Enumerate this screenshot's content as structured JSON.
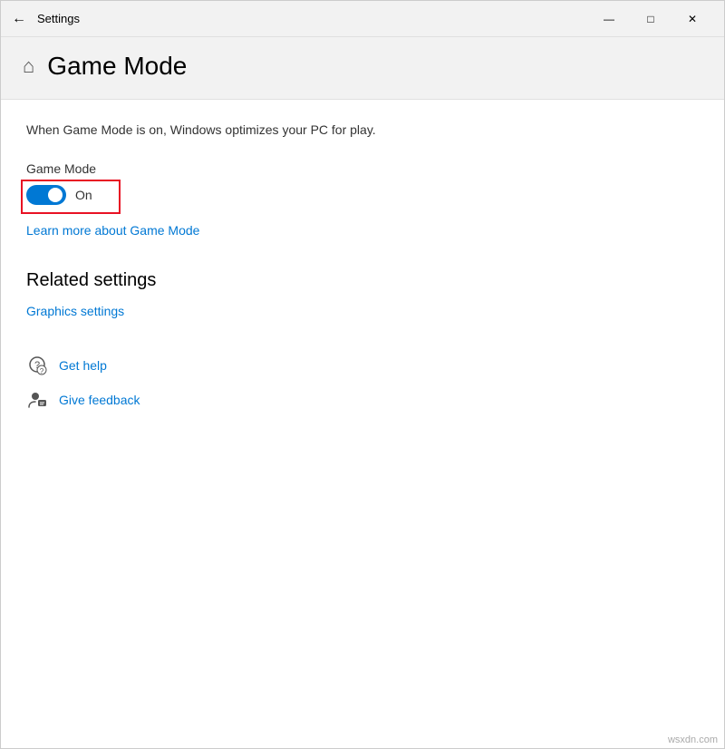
{
  "titleBar": {
    "title": "Settings",
    "backLabel": "←",
    "minimizeLabel": "—",
    "maximizeLabel": "□",
    "closeLabel": "✕"
  },
  "pageHeader": {
    "icon": "⌂",
    "title": "Game Mode"
  },
  "content": {
    "description": "When Game Mode is on, Windows optimizes your PC for play.",
    "gameModeLabel": "Game Mode",
    "toggleState": "On",
    "learnMoreLink": "Learn more about Game Mode",
    "relatedSettingsTitle": "Related settings",
    "graphicsSettingsLink": "Graphics settings",
    "getHelpLink": "Get help",
    "giveFeedbackLink": "Give feedback"
  },
  "watermark": "wsxdn.com"
}
